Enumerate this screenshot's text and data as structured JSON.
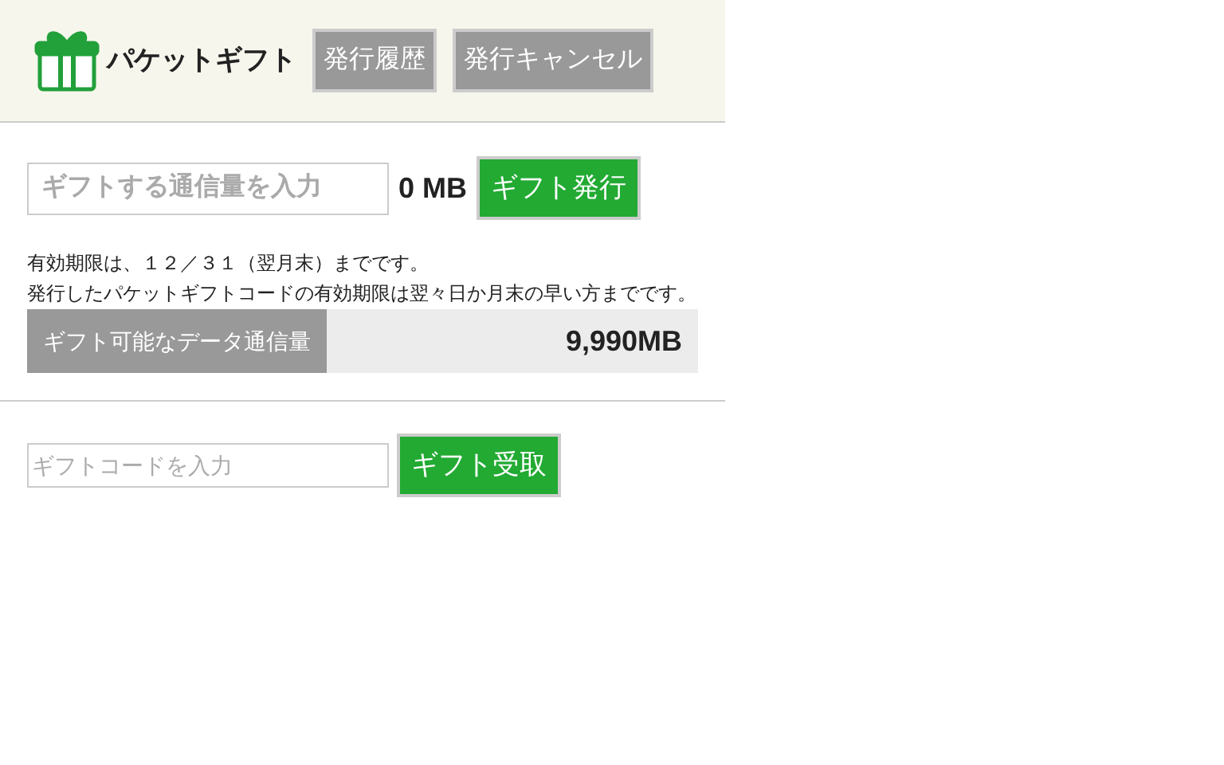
{
  "header": {
    "title": "パケットギフト",
    "buttons": [
      "発行履歴",
      "発行キャンセル"
    ]
  },
  "issue": {
    "amount_field": {
      "placeholder": "ギフトする通信量を入力"
    },
    "amount": "0 MB",
    "button": "ギフト発行"
  },
  "notes": [
    "有効期限は、１２／３１（翌月末）までです。",
    "発行したパケットギフトコードの有効期限は翌々日か月末の早い方までです。"
  ],
  "available": {
    "label": "ギフト可能なデータ通信量",
    "value": "9,990MB"
  },
  "receive": {
    "code_field": {
      "placeholder": "ギフトコードを入力"
    },
    "button": "ギフト受取"
  }
}
